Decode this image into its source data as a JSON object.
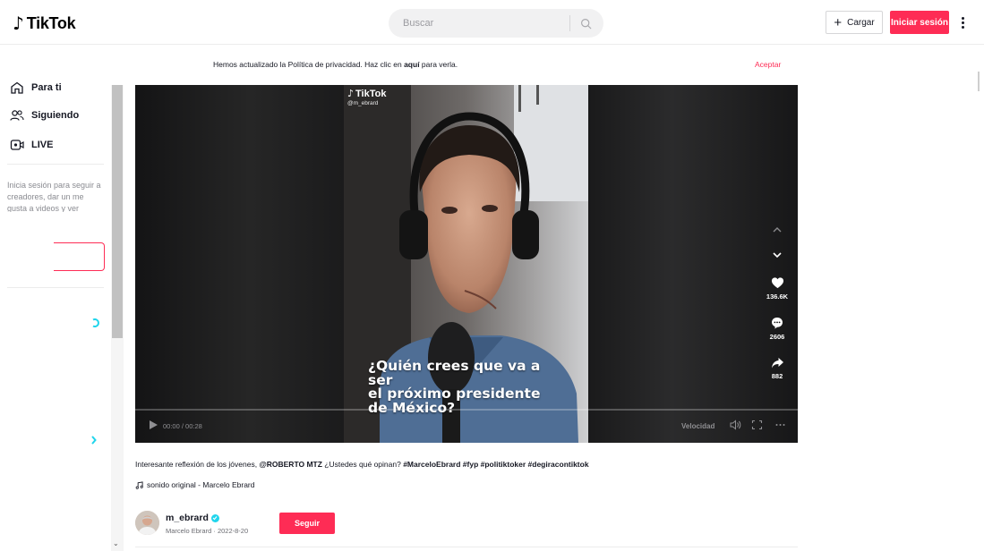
{
  "header": {
    "logo_text": "TikTok",
    "search_placeholder": "Buscar",
    "upload_label": "Cargar",
    "login_label": "Iniciar sesión"
  },
  "notice": {
    "text_before": "Hemos actualizado la Política de privacidad. Haz clic en ",
    "link_text": "aquí",
    "text_after": " para verla.",
    "accept_label": "Aceptar"
  },
  "sidebar": {
    "items": [
      {
        "label": "Para ti",
        "icon": "home-icon"
      },
      {
        "label": "Siguiendo",
        "icon": "users-icon"
      },
      {
        "label": "LIVE",
        "icon": "live-icon"
      }
    ],
    "login_prompt": "Inicia sesión para seguir a creadores, dar un me gusta a videos y ver"
  },
  "video": {
    "watermark_brand": "TikTok",
    "watermark_user": "@m_ebrard",
    "caption_lines": [
      "¿Quién crees que va a ser",
      "el próximo presidente",
      "de México?"
    ],
    "likes": "136.6K",
    "comments": "2606",
    "shares": "882",
    "time": "00:00 / 00:28",
    "progress": 0,
    "speed_label": "Velocidad"
  },
  "post": {
    "desc_text": "Interesante reflexión de los jóvenes, ",
    "mention": "@ROBERTO MTZ",
    "desc_question": " ¿Ustedes qué opinan? ",
    "hashtags": "#MarceloEbrard #fyp #politiktoker #degiracontiktok",
    "sound": "sonido original - Marcelo Ebrard",
    "username": "m_ebrard",
    "display_name": "Marcelo Ebrard",
    "separator": " · ",
    "date": "2022-8-20",
    "follow_label": "Seguir"
  },
  "colors": {
    "brand": "#fe2c55",
    "verified": "#20d5ec",
    "accent_blue": "#20d5ec"
  }
}
